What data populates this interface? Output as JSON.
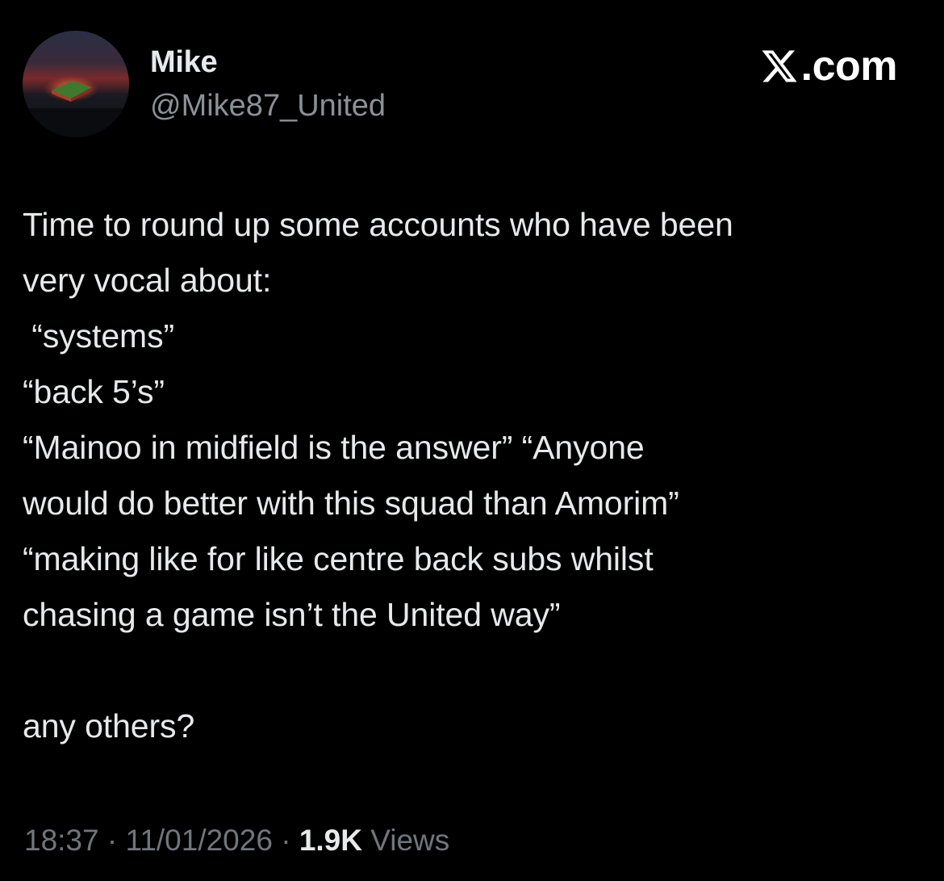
{
  "author": {
    "name": "Mike",
    "handle": "@Mike87_United",
    "avatar_icon": "stadium-avatar-icon"
  },
  "brand": {
    "label": ".com",
    "icon": "x-logo-icon"
  },
  "tweet": {
    "lines": [
      "Time to round up some accounts who have been",
      "very vocal about:",
      " “systems”",
      "“back 5’s”",
      "“Mainoo in midfield is the answer” “Anyone",
      "would do better with this squad than Amorim”",
      "“making like for like centre back subs whilst",
      "chasing a game isn’t the United way”",
      "any others?"
    ]
  },
  "meta": {
    "time": "18:37",
    "date": "11/01/2026",
    "view_count": "1.9K",
    "views_label": "Views",
    "separator": "·"
  },
  "colors": {
    "background": "#000000",
    "primary_text": "#e7e9ea",
    "secondary_text": "#71767b"
  }
}
